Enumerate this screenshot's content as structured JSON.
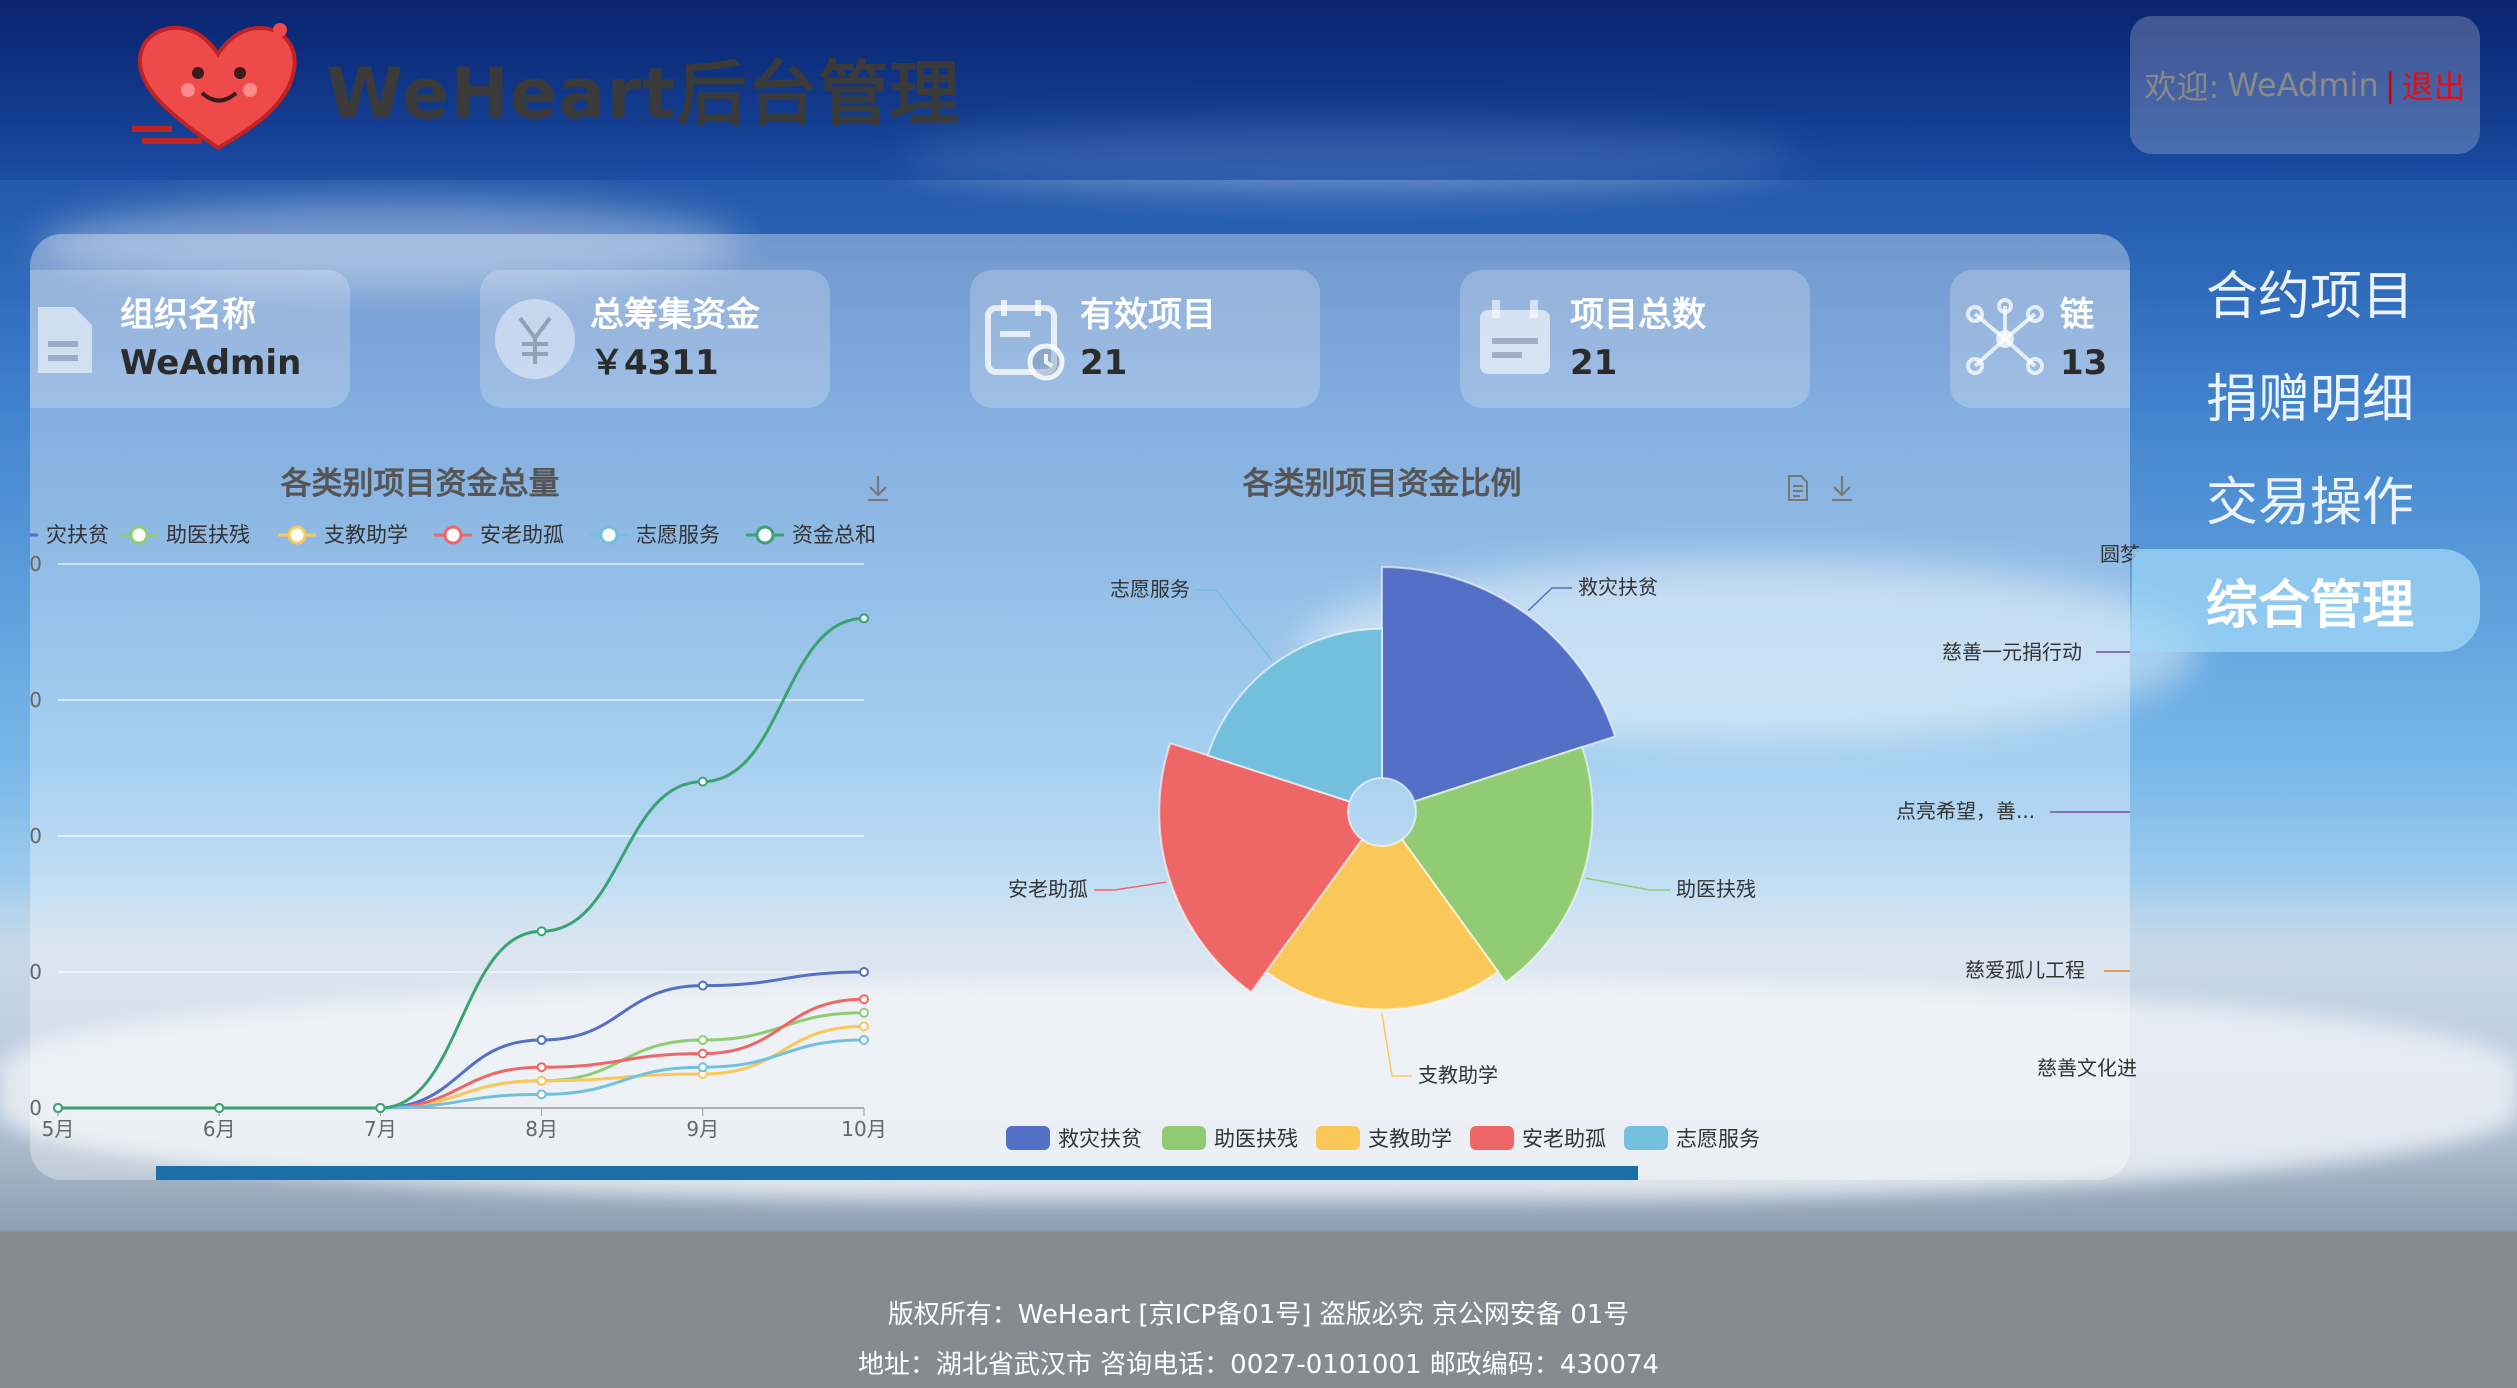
{
  "header": {
    "title": "WeHeart后台管理",
    "welcome_prefix": "欢迎:",
    "user": "WeAdmin",
    "separator": "|",
    "logout": "退出"
  },
  "cards": [
    {
      "label": "组织名称",
      "value": "WeAdmin",
      "icon": "document-icon"
    },
    {
      "label": "总筹集资金",
      "value": "￥4311",
      "icon": "yen-icon"
    },
    {
      "label": "有效项目",
      "value": "21",
      "icon": "calendar-clock-icon"
    },
    {
      "label": "项目总数",
      "value": "21",
      "icon": "calendar-icon"
    },
    {
      "label": "链",
      "value": "13",
      "icon": "network-icon"
    }
  ],
  "menu": [
    {
      "label": "合约项目",
      "active": false
    },
    {
      "label": "捐赠明细",
      "active": false
    },
    {
      "label": "交易操作",
      "active": false
    },
    {
      "label": "综合管理",
      "active": true
    }
  ],
  "line_chart": {
    "title": "各类别项目资金总量",
    "legend": [
      "救灾扶贫",
      "助医扶残",
      "支教助学",
      "安老助孤",
      "志愿服务",
      "资金总和"
    ],
    "legend_visible": [
      "灾扶贫",
      "助医扶残",
      "支教助学",
      "安老助孤",
      "志愿服务",
      "资金总和"
    ],
    "y_ticks": [
      "0",
      "0",
      "0",
      "0",
      "0"
    ],
    "download_icon": "download-icon"
  },
  "pie_chart": {
    "title": "各类别项目资金比例",
    "legend": [
      "救灾扶贫",
      "助医扶残",
      "支教助学",
      "安老助孤",
      "志愿服务"
    ],
    "labels": [
      "救灾扶贫",
      "助医扶残",
      "支教助学",
      "安老助孤",
      "志愿服务"
    ],
    "icons": [
      "data-view-icon",
      "download-icon"
    ]
  },
  "right_chart_labels": [
    "圆梦",
    "慈善一元捐行动",
    "点亮希望，善...",
    "慈爱孤儿工程",
    "慈善文化进"
  ],
  "footer": {
    "line1": "版权所有：WeHeart   [京ICP备01号] 盗版必究  京公网安备 01号",
    "line2": "地址：湖北省武汉市  咨询电话：0027-0101001  邮政编码：430074"
  },
  "colors": {
    "blue": "#5470c6",
    "green": "#91cc75",
    "yellow": "#fac858",
    "red": "#ee6666",
    "cyan": "#73c0de",
    "teal": "#3ba272",
    "logout": "#e0101a"
  },
  "chart_data": [
    {
      "type": "line",
      "title": "各类别项目资金总量",
      "categories": [
        "5月",
        "6月",
        "7月",
        "8月",
        "9月",
        "10月"
      ],
      "series": [
        {
          "name": "救灾扶贫",
          "values": [
            0,
            0,
            0,
            500,
            900,
            1000
          ]
        },
        {
          "name": "助医扶残",
          "values": [
            0,
            0,
            0,
            200,
            500,
            700
          ]
        },
        {
          "name": "支教助学",
          "values": [
            0,
            0,
            0,
            200,
            250,
            600
          ]
        },
        {
          "name": "安老助孤",
          "values": [
            0,
            0,
            0,
            300,
            400,
            800
          ]
        },
        {
          "name": "志愿服务",
          "values": [
            0,
            0,
            0,
            100,
            300,
            500
          ]
        },
        {
          "name": "资金总和",
          "values": [
            0,
            0,
            0,
            1300,
            2400,
            3600
          ]
        }
      ],
      "ylim": [
        0,
        4000
      ]
    },
    {
      "type": "pie",
      "title": "各类别项目资金比例",
      "rose": true,
      "slices": [
        {
          "name": "救灾扶贫",
          "value": 1000
        },
        {
          "name": "助医扶残",
          "value": 700
        },
        {
          "name": "支教助学",
          "value": 600
        },
        {
          "name": "安老助孤",
          "value": 800
        },
        {
          "name": "志愿服务",
          "value": 500
        }
      ]
    }
  ]
}
